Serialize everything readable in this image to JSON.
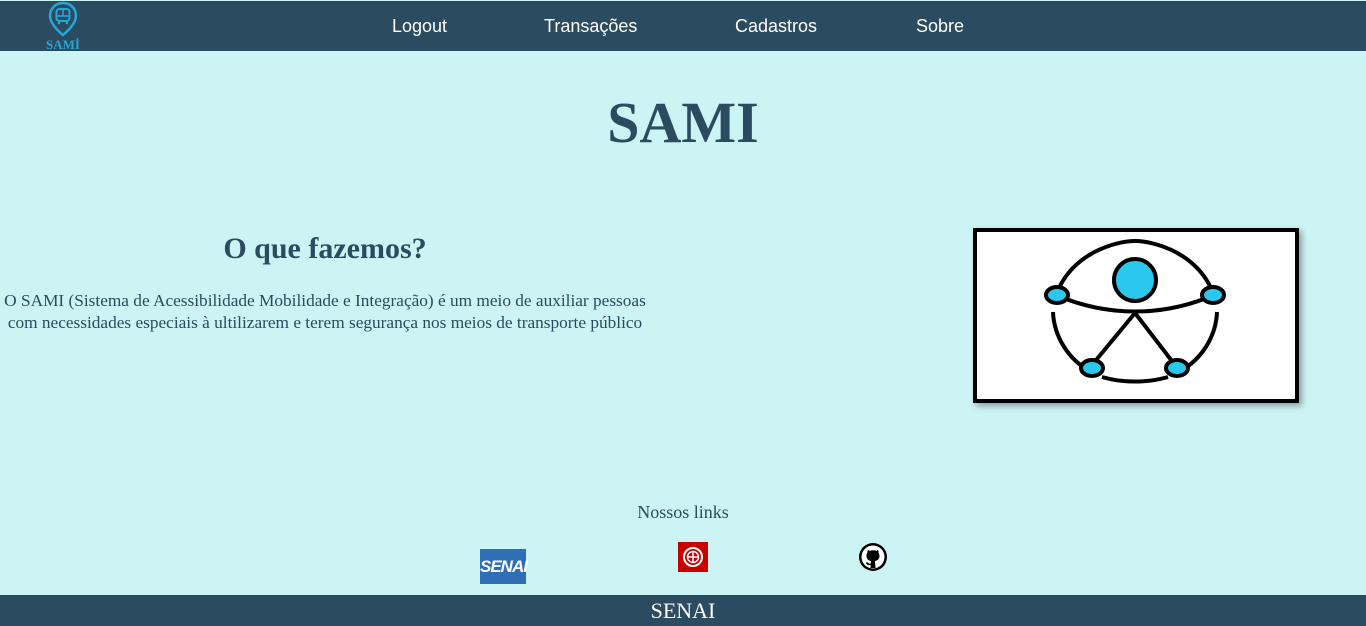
{
  "brand": {
    "logo_text": "SAMİ",
    "accent": "#27a6d8",
    "primary": "#2b4b60",
    "background": "#cdf4f4"
  },
  "nav": {
    "logout": "Logout",
    "transactions": "Transações",
    "registrations": "Cadastros",
    "about": "Sobre"
  },
  "main": {
    "title": "SAMI",
    "heading": "O que fazemos?",
    "description": "O SAMI (Sistema de Acessibilidade Mobilidade e Integração) é um meio de auxiliar pessoas com necessidades especiais à ultilizarem e terem segurança nos meios de transporte público",
    "image_icon": "accessibility-icon"
  },
  "links": {
    "label": "Nossos links",
    "items": [
      {
        "name": "senai-logo",
        "text": "SENAI"
      },
      {
        "name": "sesi-logo",
        "icon": "sesi-icon"
      },
      {
        "name": "github-logo",
        "icon": "github-icon"
      }
    ]
  },
  "footer": {
    "text": "SENAI"
  }
}
